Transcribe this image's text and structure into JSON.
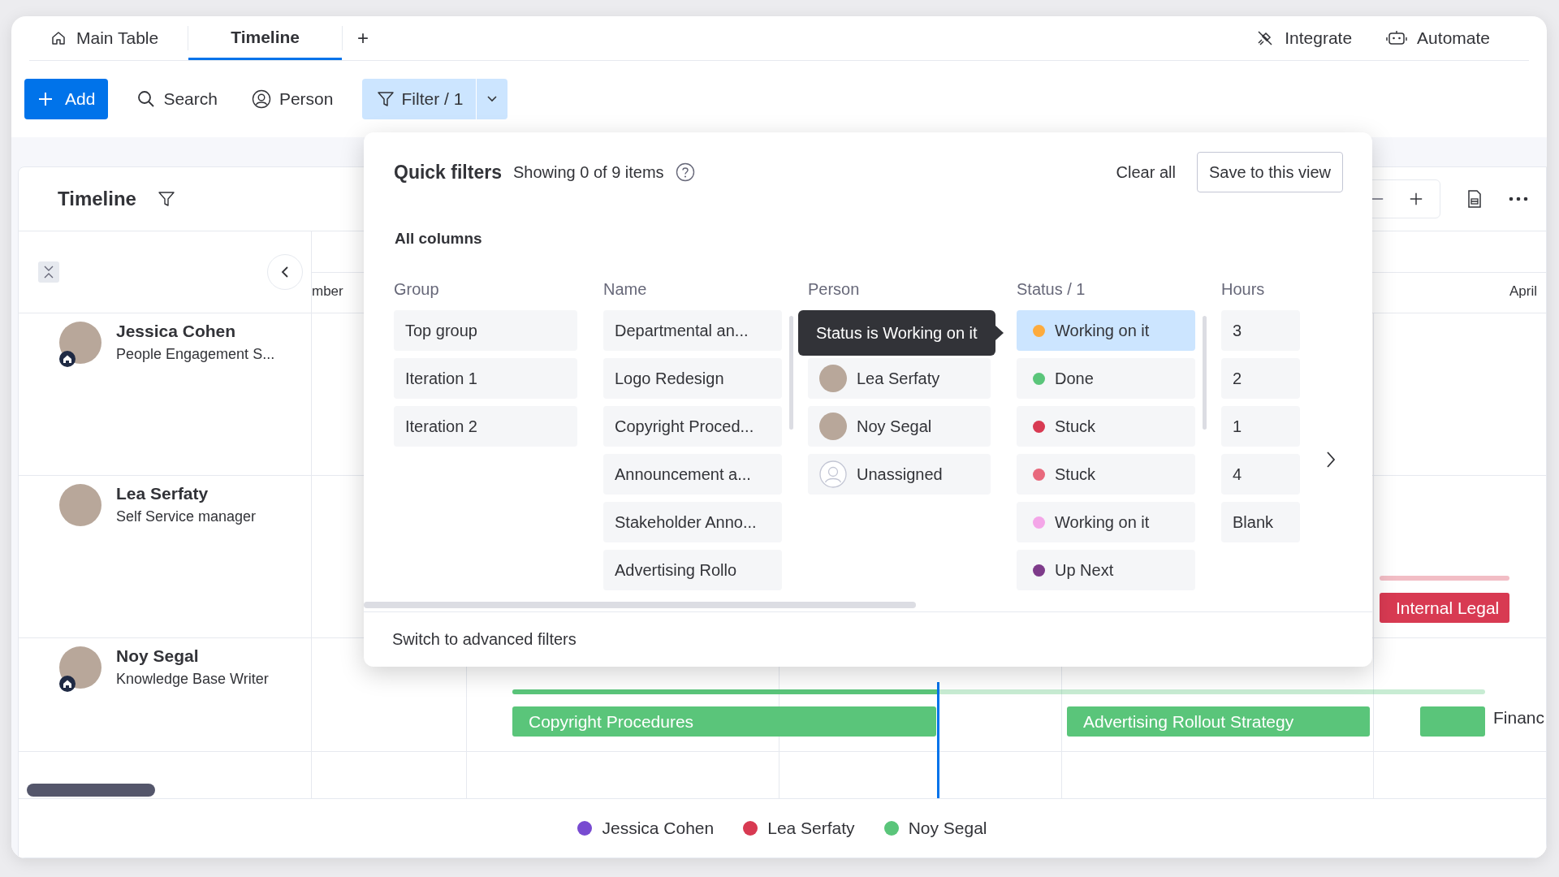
{
  "tabs": [
    {
      "label": "Main Table",
      "selected": false
    },
    {
      "label": "Timeline",
      "selected": true
    }
  ],
  "add_tab": "+",
  "top_actions": [
    {
      "label": "Integrate"
    },
    {
      "label": "Automate"
    }
  ],
  "toolbar": {
    "add": "Add",
    "search": "Search",
    "person": "Person",
    "filter": "Filter / 1"
  },
  "timeline": {
    "title": "Timeline",
    "months": [
      "mber",
      "April"
    ],
    "people": [
      {
        "name": "Jessica Cohen",
        "role": "People Engagement S...",
        "home_badge": true
      },
      {
        "name": "Lea Serfaty",
        "role": "Self Service manager",
        "home_badge": false,
        "bars": [
          {
            "label": "Internal Legal",
            "kind": "inside",
            "color": "#d83a52"
          }
        ]
      },
      {
        "name": "Noy Segal",
        "role": "Knowledge Base Writer",
        "home_badge": true,
        "bars": [
          {
            "label": "Copyright Procedures",
            "kind": "inside",
            "color": "#5ac57a"
          },
          {
            "label": "Advertising Rollout Strategy",
            "kind": "inside",
            "color": "#5ac57a"
          },
          {
            "label": "Financ",
            "kind": "outside",
            "color": "#5ac57a"
          }
        ]
      }
    ],
    "legend": [
      {
        "name": "Jessica Cohen",
        "color": "#784bd1"
      },
      {
        "name": "Lea Serfaty",
        "color": "#d83a52"
      },
      {
        "name": "Noy Segal",
        "color": "#5ac57a"
      }
    ]
  },
  "quick_filters": {
    "title": "Quick filters",
    "summary": "Showing 0 of 9 items",
    "clear": "Clear all",
    "save": "Save to this view",
    "section": "All columns",
    "tooltip": "Status is Working on it",
    "columns": [
      {
        "kind": "group",
        "header": "Group",
        "options": [
          {
            "label": "Top group",
            "selected": false
          },
          {
            "label": "Iteration 1",
            "selected": false
          },
          {
            "label": "Iteration 2",
            "selected": false
          }
        ]
      },
      {
        "kind": "name",
        "header": "Name",
        "options": [
          {
            "label": "Departmental an...",
            "selected": false
          },
          {
            "label": "Logo Redesign",
            "selected": false
          },
          {
            "label": "Copyright Proced...",
            "selected": false
          },
          {
            "label": "Announcement a...",
            "selected": false
          },
          {
            "label": "Stakeholder Anno...",
            "selected": false
          },
          {
            "label": "Advertising Rollo",
            "selected": false
          }
        ]
      },
      {
        "kind": "person",
        "header": "Person",
        "options": [
          {
            "label": "Lea Serfaty",
            "kind": "photo",
            "selected": false
          },
          {
            "label": "Noy Segal",
            "kind": "photo",
            "selected": false
          },
          {
            "label": "Unassigned",
            "kind": "empty",
            "selected": false
          }
        ]
      },
      {
        "kind": "status",
        "header": "Status / 1",
        "options": [
          {
            "label": "Working on it",
            "color": "#fdab3d",
            "selected": true
          },
          {
            "label": "Done",
            "color": "#5ac57a",
            "selected": false
          },
          {
            "label": "Stuck",
            "color": "#d83a52",
            "selected": false
          },
          {
            "label": "Stuck",
            "color": "#e8697d",
            "selected": false
          },
          {
            "label": "Working on it",
            "color": "#f4a6e8",
            "selected": false
          },
          {
            "label": "Up Next",
            "color": "#7e3b8a",
            "selected": false
          }
        ]
      },
      {
        "kind": "hours",
        "header": "Hours",
        "options": [
          {
            "label": "3",
            "selected": false
          },
          {
            "label": "2",
            "selected": false
          },
          {
            "label": "1",
            "selected": false
          },
          {
            "label": "4",
            "selected": false
          },
          {
            "label": "Blank",
            "selected": false
          }
        ]
      }
    ],
    "advanced": "Switch to advanced filters"
  }
}
